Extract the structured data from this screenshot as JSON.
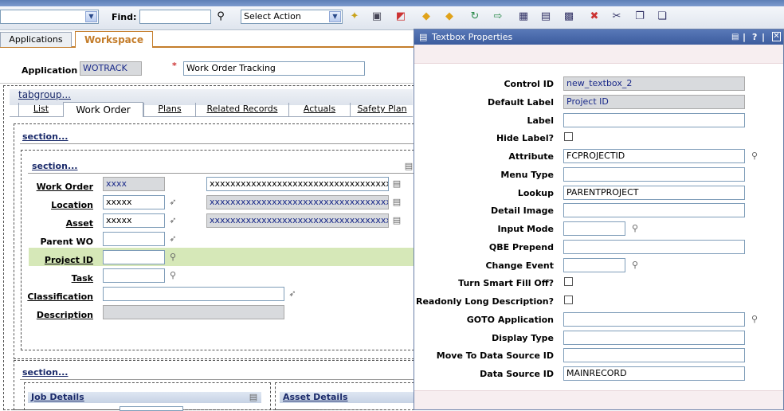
{
  "toolbar": {
    "find_label": "Find:",
    "find_value": "",
    "action_select": "Select Action"
  },
  "tabs": {
    "applications": "Applications",
    "workspace": "Workspace"
  },
  "app": {
    "label": "Application",
    "code": "WOTRACK",
    "required": "*",
    "description": "Work Order Tracking"
  },
  "tabgroup": {
    "title": "tabgroup...",
    "tabs": [
      "List",
      "Work Order",
      "Plans",
      "Related Records",
      "Actuals",
      "Safety Plan"
    ]
  },
  "sections": {
    "outer": "section...",
    "inner": "section...",
    "lower": "section..."
  },
  "fields": {
    "work_order": {
      "label": "Work Order",
      "value": "xxxx",
      "desc": "xxxxxxxxxxxxxxxxxxxxxxxxxxxxxxxxxxxxxxxxx"
    },
    "location": {
      "label": "Location",
      "value": "xxxxx",
      "desc": "xxxxxxxxxxxxxxxxxxxxxxxxxxxxxxxxxxxxxxxx"
    },
    "asset": {
      "label": "Asset",
      "value": "xxxxx",
      "desc": "xxxxxxxxxxxxxxxxxxxxxxxxxxxxxxxxxxxxxxxxx"
    },
    "parent_wo": {
      "label": "Parent WO",
      "value": ""
    },
    "project_id": {
      "label": "Project ID",
      "value": ""
    },
    "task": {
      "label": "Task",
      "value": ""
    },
    "classification": {
      "label": "Classification",
      "value": ""
    },
    "description": {
      "label": "Description",
      "value": ""
    }
  },
  "panels": {
    "job_details": "Job Details",
    "asset_details": "Asset Details"
  },
  "dialog": {
    "title": "Textbox Properties",
    "rows": [
      {
        "label": "Control ID",
        "value": "new_textbox_2",
        "type": "readonly"
      },
      {
        "label": "Default Label",
        "value": "Project ID",
        "type": "readonly"
      },
      {
        "label": "Label",
        "value": "",
        "type": "text"
      },
      {
        "label": "Hide Label?",
        "value": "",
        "type": "check"
      },
      {
        "label": "Attribute",
        "value": "FCPROJECTID",
        "type": "text-search"
      },
      {
        "label": "Menu Type",
        "value": "",
        "type": "text"
      },
      {
        "label": "Lookup",
        "value": "PARENTPROJECT",
        "type": "text"
      },
      {
        "label": "Detail Image",
        "value": "",
        "type": "text"
      },
      {
        "label": "Input Mode",
        "value": "",
        "type": "short-search"
      },
      {
        "label": "QBE Prepend",
        "value": "",
        "type": "text"
      },
      {
        "label": "Change Event",
        "value": "",
        "type": "short-search"
      },
      {
        "label": "Turn Smart Fill Off?",
        "value": "",
        "type": "check"
      },
      {
        "label": "Readonly Long Description?",
        "value": "",
        "type": "check"
      },
      {
        "label": "GOTO Application",
        "value": "",
        "type": "text-search"
      },
      {
        "label": "Display Type",
        "value": "",
        "type": "text"
      },
      {
        "label": "Move To Data Source ID",
        "value": "",
        "type": "text"
      },
      {
        "label": "Data Source ID",
        "value": "MAINRECORD",
        "type": "text"
      }
    ]
  },
  "colors": {
    "accent": "#c47d2b",
    "highlight": "#d6e8b8",
    "header": "#3c5c9e"
  }
}
